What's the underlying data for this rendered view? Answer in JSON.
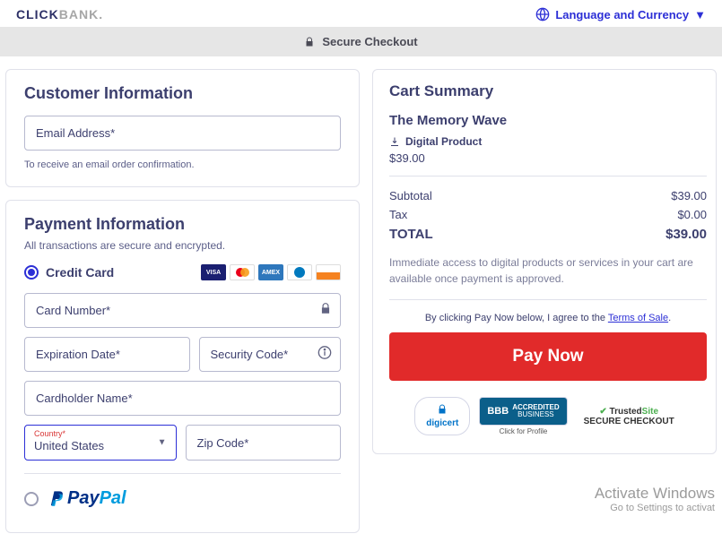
{
  "header": {
    "logo_click": "CLICK",
    "logo_bank": "BANK.",
    "lang_label": "Language and Currency"
  },
  "secure_bar": "Secure Checkout",
  "customer": {
    "heading": "Customer Information",
    "email_placeholder": "Email Address*",
    "hint": "To receive an email order confirmation."
  },
  "payment": {
    "heading": "Payment Information",
    "sub": "All transactions are secure and encrypted.",
    "credit_label": "Credit Card",
    "card_number_ph": "Card Number*",
    "exp_ph": "Expiration Date*",
    "sec_ph": "Security Code*",
    "name_ph": "Cardholder Name*",
    "country_label": "Country*",
    "country_value": "United States",
    "zip_ph": "Zip Code*",
    "paypal_p1": "Pay",
    "paypal_p2": "Pal"
  },
  "cart": {
    "heading": "Cart Summary",
    "product_title": "The Memory Wave",
    "dl_label": "Digital Product",
    "price": "$39.00",
    "subtotal_label": "Subtotal",
    "subtotal_value": "$39.00",
    "tax_label": "Tax",
    "tax_value": "$0.00",
    "total_label": "TOTAL",
    "total_value": "$39.00",
    "note": "Immediate access to digital products or services in your cart are available once payment is approved.",
    "agree_pre": "By clicking Pay Now below, I agree to the ",
    "agree_link": "Terms of Sale",
    "paynow": "Pay Now",
    "digicert": "digicert",
    "bbb_line1": "ACCREDITED",
    "bbb_line2": "BUSINESS",
    "bbb_caption": "Click for Profile",
    "trusted_pre": "Trusted",
    "trusted_suf": "Site",
    "trusted_sub": "SECURE CHECKOUT"
  },
  "watermark": {
    "title": "Activate Windows",
    "sub": "Go to Settings to activat"
  }
}
